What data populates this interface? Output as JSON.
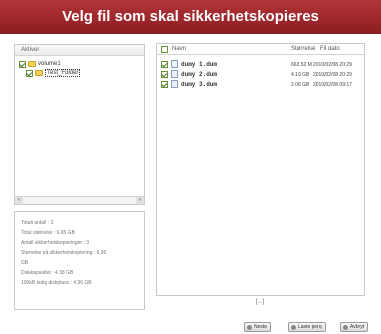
{
  "title": "Velg fil som skal sikkerhetskopieres",
  "tree": {
    "header": "Aktiver",
    "nodes": [
      {
        "label": "volume1",
        "checked": true
      },
      {
        "label": "Test_Folder",
        "checked": true
      }
    ],
    "scroll_left": "<",
    "scroll_right": ">"
  },
  "info": {
    "lines": [
      "Totalt antall : 3",
      "Total størrelse : 6.95 GB",
      "Antall sikkerhetskopieringer : 3",
      "Størrelse på sikkerhetskopiering : 6.95",
      "GB",
      "Diskkapasitet : 4.38 GB",
      "100kB ledig diskplass : 4.36 GB"
    ]
  },
  "list": {
    "headers": {
      "name": "Navn",
      "size": "Størrelse",
      "date": "Fil dato"
    },
    "rows": [
      {
        "name": "dumy 1.dum",
        "size": "663.52 M",
        "date": "2010/02/08 20:29",
        "checked": true
      },
      {
        "name": "dumy 2.dum",
        "size": "4.19 GB",
        "date": "2010/02/08 20:29",
        "checked": true
      },
      {
        "name": "dumy 3.dum",
        "size": "2.06 GB",
        "date": "2010/02/08 09:17",
        "checked": true
      }
    ]
  },
  "pager": "[...]",
  "buttons": {
    "next": "Neste",
    "back": "Laste perq",
    "cancel": "Avbryt"
  }
}
